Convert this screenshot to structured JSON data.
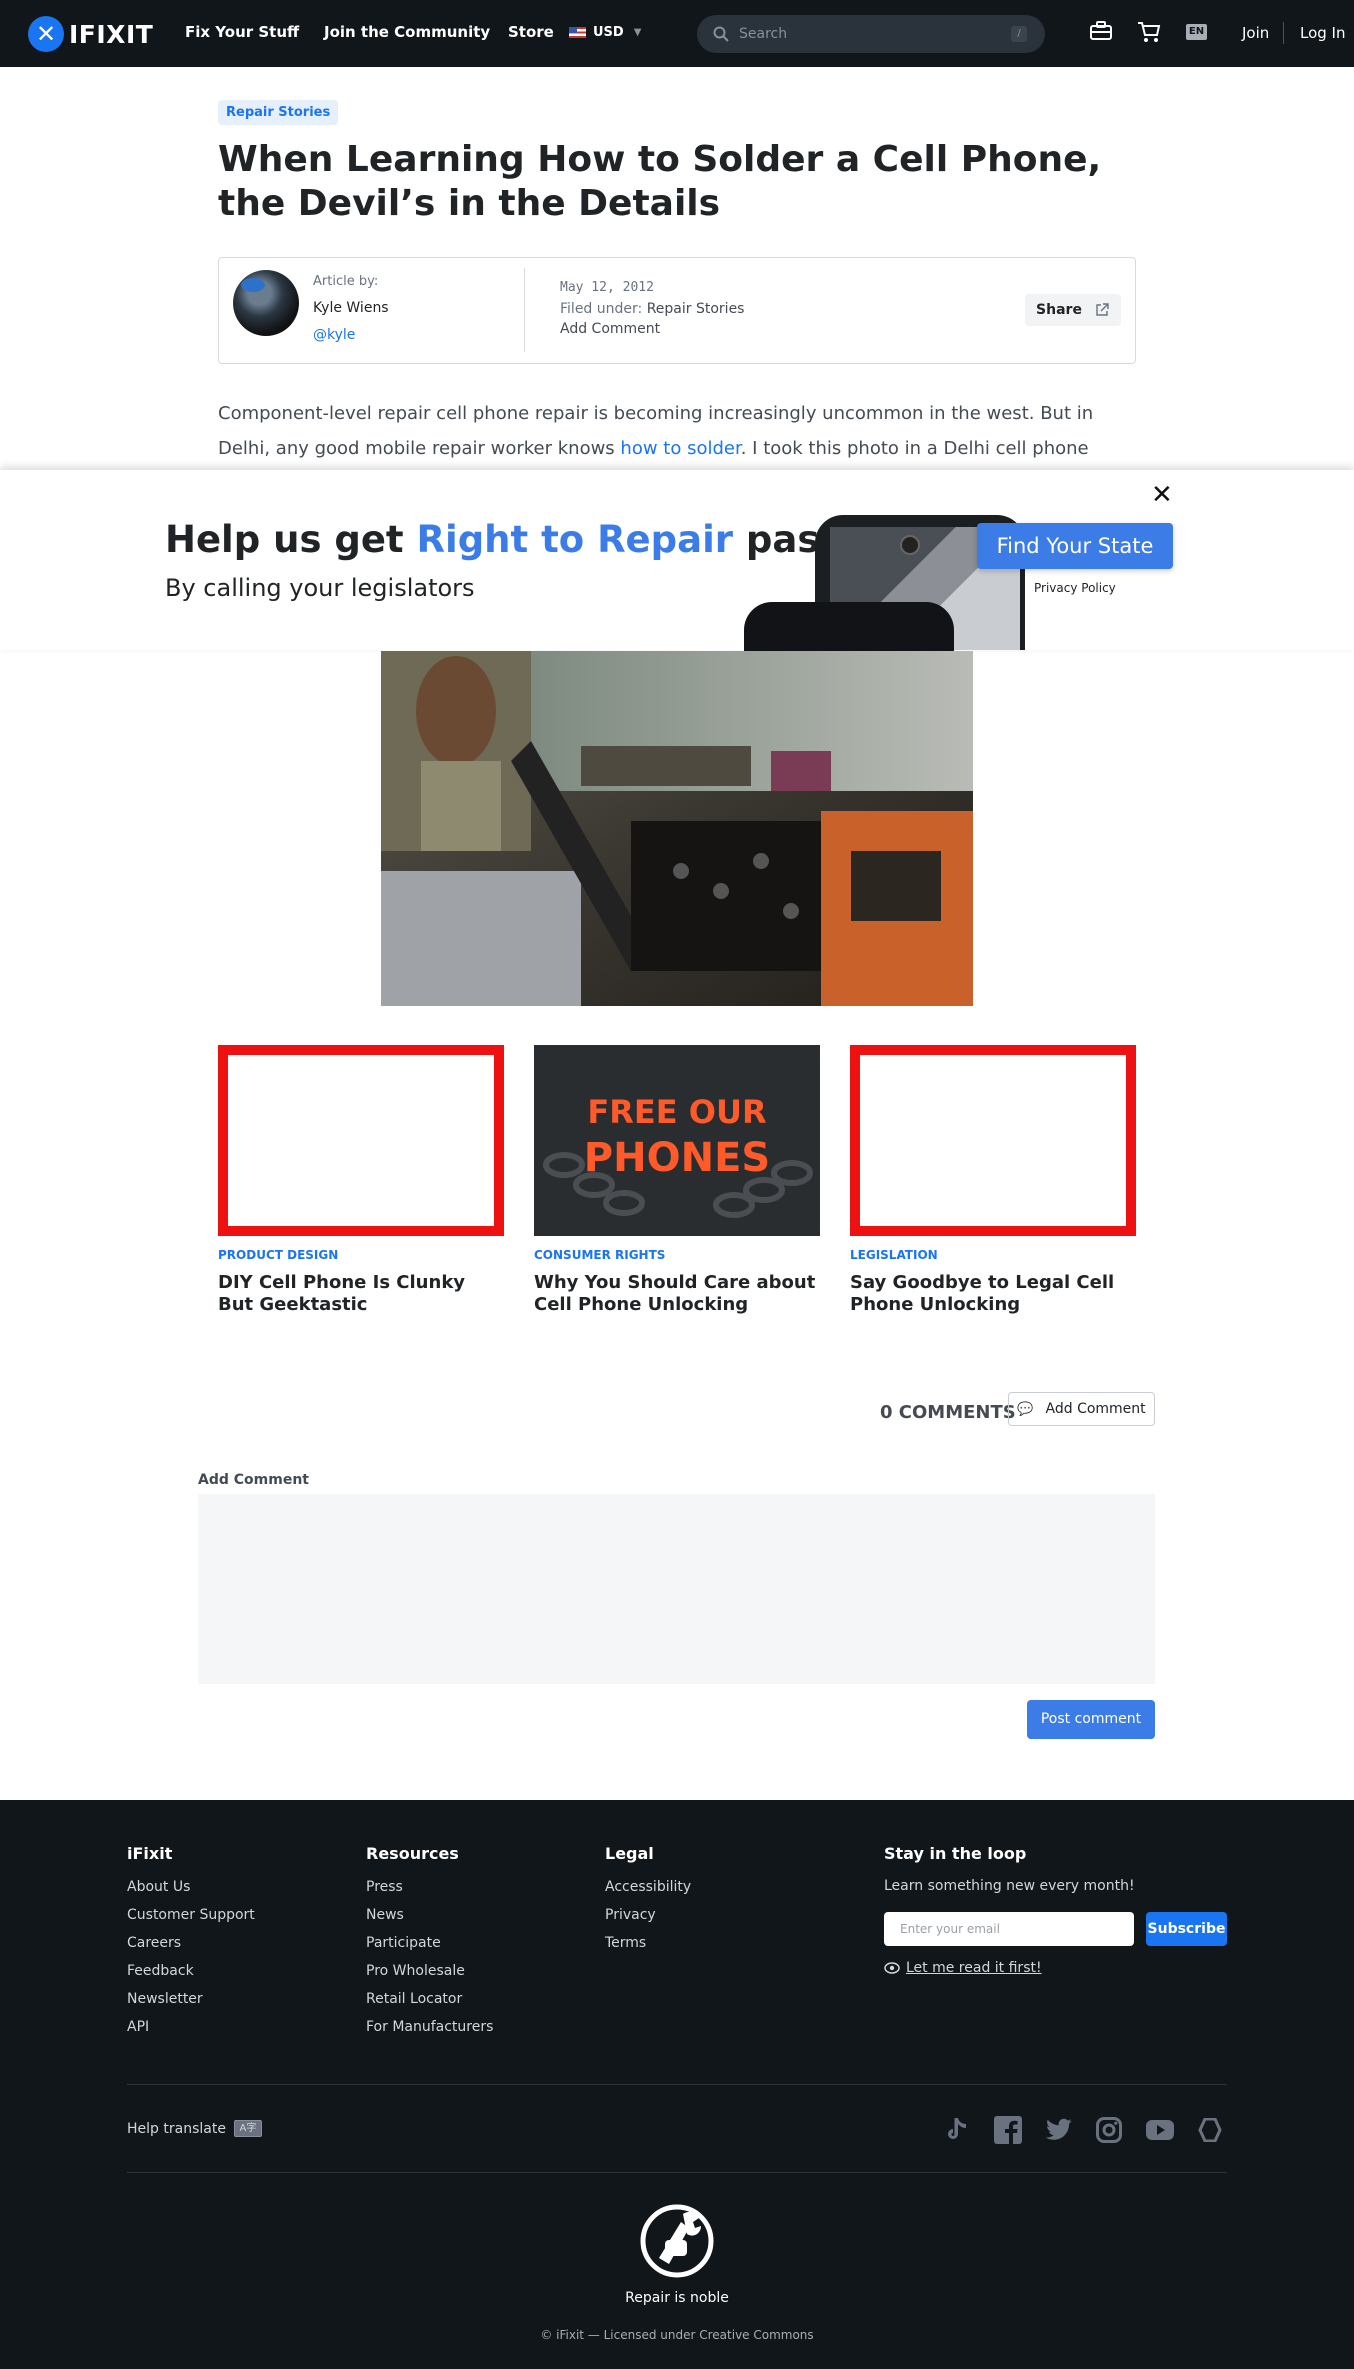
{
  "nav": {
    "logo_text": "IFIXIT",
    "links": [
      "Fix Your Stuff",
      "Join the Community",
      "Store"
    ],
    "currency": "USD",
    "search_placeholder": "Search",
    "search_shortcut": "/",
    "lang": "EN",
    "join": "Join",
    "login": "Log In"
  },
  "article": {
    "badge": "Repair Stories",
    "title": "When Learning How to Solder a Cell Phone, the Devil’s in the Details",
    "byline": {
      "label": "Article by:",
      "name": "Kyle Wiens",
      "handle": "@kyle",
      "date": "May 12, 2012",
      "filed_label": "Filed under:",
      "filed_value": "Repair Stories",
      "add_comment": "Add Comment",
      "share": "Share"
    },
    "body_pre": "Component-level repair cell phone repair is becoming increasingly uncommon in the west. But in Delhi, any good mobile repair worker knows ",
    "body_link": "how to solder",
    "body_post": ". I took this photo in a Delhi cell phone repair school. This"
  },
  "banner": {
    "title_pre": "Help us get ",
    "title_accent": "Right to Repair",
    "title_post": " passed",
    "subtitle": "By calling your legislators",
    "cta": "Find Your State",
    "privacy": "Privacy Policy",
    "close": "✕"
  },
  "related": [
    {
      "category": "PRODUCT DESIGN",
      "title": "DIY Cell Phone Is Clunky But Geektastic"
    },
    {
      "category": "CONSUMER RIGHTS",
      "title": "Why You Should Care about Cell Phone Unlocking",
      "image_text_1": "FREE OUR",
      "image_text_2": "PHONES"
    },
    {
      "category": "LEGISLATION",
      "title": "Say Goodbye to Legal Cell Phone Unlocking"
    }
  ],
  "comments": {
    "count": "0 COMMENTS",
    "add_button": "Add Comment",
    "form_label": "Add Comment",
    "post_button": "Post comment"
  },
  "footer": {
    "col1": {
      "title": "iFixit",
      "links": [
        "About Us",
        "Customer Support",
        "Careers",
        "Feedback",
        "Newsletter",
        "API"
      ]
    },
    "col2": {
      "title": "Resources",
      "links": [
        "Press",
        "News",
        "Participate",
        "Pro Wholesale",
        "Retail Locator",
        "For Manufacturers"
      ]
    },
    "col3": {
      "title": "Legal",
      "links": [
        "Accessibility",
        "Privacy",
        "Terms"
      ]
    },
    "newsletter": {
      "title": "Stay in the loop",
      "subtitle": "Learn something new every month!",
      "placeholder": "Enter your email",
      "button": "Subscribe",
      "read_first": "Let me read it first!"
    },
    "help_translate": "Help translate",
    "social_icons": [
      "tiktok-icon",
      "facebook-icon",
      "twitter-icon",
      "instagram-icon",
      "youtube-icon",
      "hive-icon"
    ],
    "tagline": "Repair is noble",
    "license": "© iFixit — Licensed under Creative Commons"
  }
}
